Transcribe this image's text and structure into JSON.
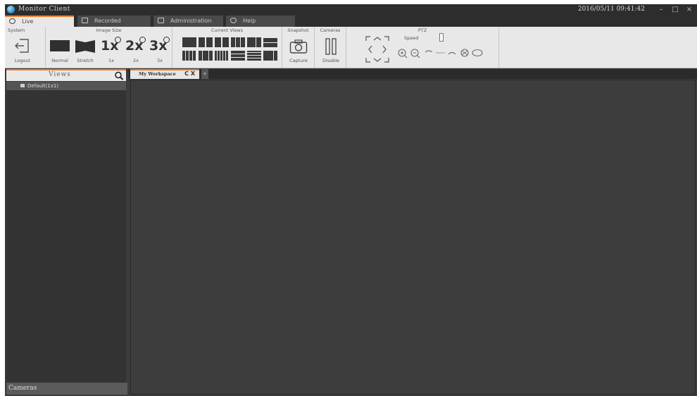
{
  "window": {
    "title": "Monitor Client",
    "datetime": "2016/05/11 09:41:42",
    "controls": {
      "minimize": "–",
      "maximize": "□",
      "close": "×"
    }
  },
  "tabs": [
    {
      "label": "Live",
      "icon": "live-icon",
      "active": true
    },
    {
      "label": "Recorded",
      "icon": "recorded-icon"
    },
    {
      "label": "Administration",
      "icon": "admin-icon"
    },
    {
      "label": "Help",
      "icon": "help-icon"
    }
  ],
  "ribbon": {
    "system": {
      "title": "System",
      "logout": "Logout"
    },
    "image_size": {
      "title": "Image Size",
      "normal": "Normal",
      "stretch": "Stretch",
      "zoom1": {
        "text": "1x",
        "label": "1x"
      },
      "zoom2": {
        "text": "2x",
        "label": "2x"
      },
      "zoom3": {
        "text": "3x",
        "label": "3x"
      }
    },
    "current_views": {
      "title": "Current Views"
    },
    "snapshot": {
      "title": "Snapshot",
      "capture": "Capture"
    },
    "cameras": {
      "title": "Cameras",
      "disable": "Disable"
    },
    "ptz": {
      "title": "PTZ",
      "speed": "Speed"
    }
  },
  "left": {
    "views_label": "Views",
    "tree_item": "Default(1x1)",
    "cameras_label": "Cameras"
  },
  "workspace": {
    "tab_label": "My Workspace",
    "tab_close": "C X",
    "add_tab": "+"
  },
  "colors": {
    "accent": "#f07c2a",
    "dark_bg": "#3c3c3c",
    "ribbon_bg": "#e8e8e8"
  }
}
